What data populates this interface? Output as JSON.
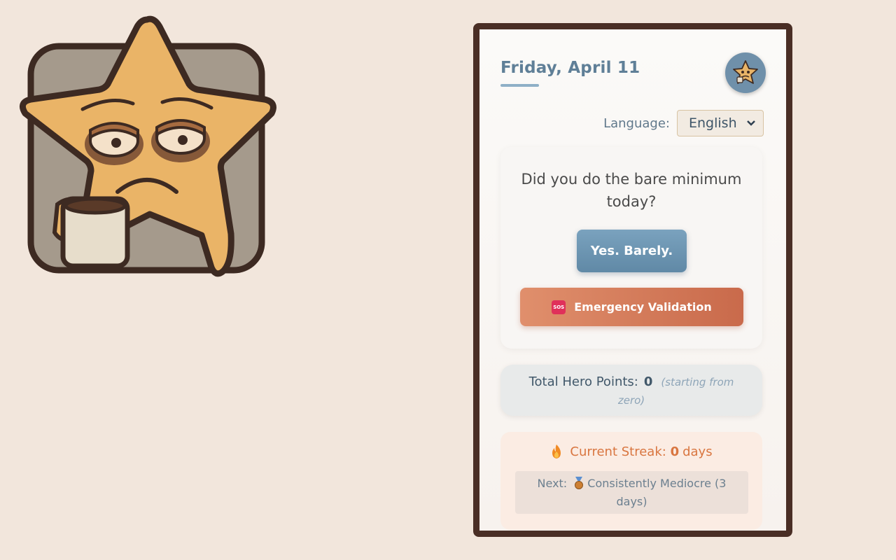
{
  "mascot": {
    "icon": "tired-star-holding-coffee-icon"
  },
  "popup": {
    "date": "Friday, April 11",
    "avatar_icon": "tired-star-avatar-icon",
    "language": {
      "label": "Language:",
      "selected": "English"
    },
    "question": "Did you do the bare minimum today?",
    "yes_button": "Yes. Barely.",
    "sos_button": {
      "icon_text": "SOS",
      "label": "Emergency Validation"
    },
    "points": {
      "label": "Total Hero Points:",
      "value": "0",
      "note_1": "(starting from",
      "note_2": "zero)"
    },
    "streak": {
      "icon": "fire-icon",
      "label": "Current Streak:",
      "value": "0",
      "unit": "days"
    },
    "next": {
      "prefix": "Next:",
      "icon": "medal-icon",
      "label": "Consistently Mediocre (3",
      "label_2": "days)"
    }
  },
  "colors": {
    "background": "#f2e6dc",
    "frame": "#4a2e25",
    "primary": "#6f93b0",
    "accent": "#d97640"
  }
}
